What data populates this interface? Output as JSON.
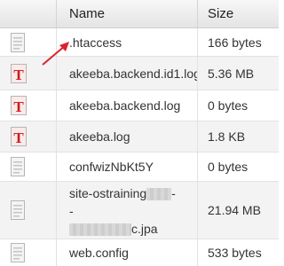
{
  "columns": {
    "name": "Name",
    "size": "Size"
  },
  "colors": {
    "accent_red": "#c81e1e",
    "arrow": "#d9232e",
    "row_alt": "#f3f3f3"
  },
  "files": [
    {
      "name": ".htaccess",
      "size": "166 bytes",
      "icon": "generic-file-icon",
      "highlighted": true
    },
    {
      "name": "akeeba.backend.id1.log",
      "size": "5.36 MB",
      "icon": "text-file-icon"
    },
    {
      "name": "akeeba.backend.log",
      "size": "0 bytes",
      "icon": "text-file-icon"
    },
    {
      "name": "akeeba.log",
      "size": "1.8 KB",
      "icon": "text-file-icon"
    },
    {
      "name": "confwizNbKt5Y",
      "size": "0 bytes",
      "icon": "generic-file-icon"
    },
    {
      "name_parts": [
        "site-ostraining",
        "-",
        "-",
        "c.jpa"
      ],
      "size": "21.94 MB",
      "icon": "generic-file-icon"
    },
    {
      "name": "web.config",
      "size": "533 bytes",
      "icon": "generic-file-icon"
    }
  ]
}
